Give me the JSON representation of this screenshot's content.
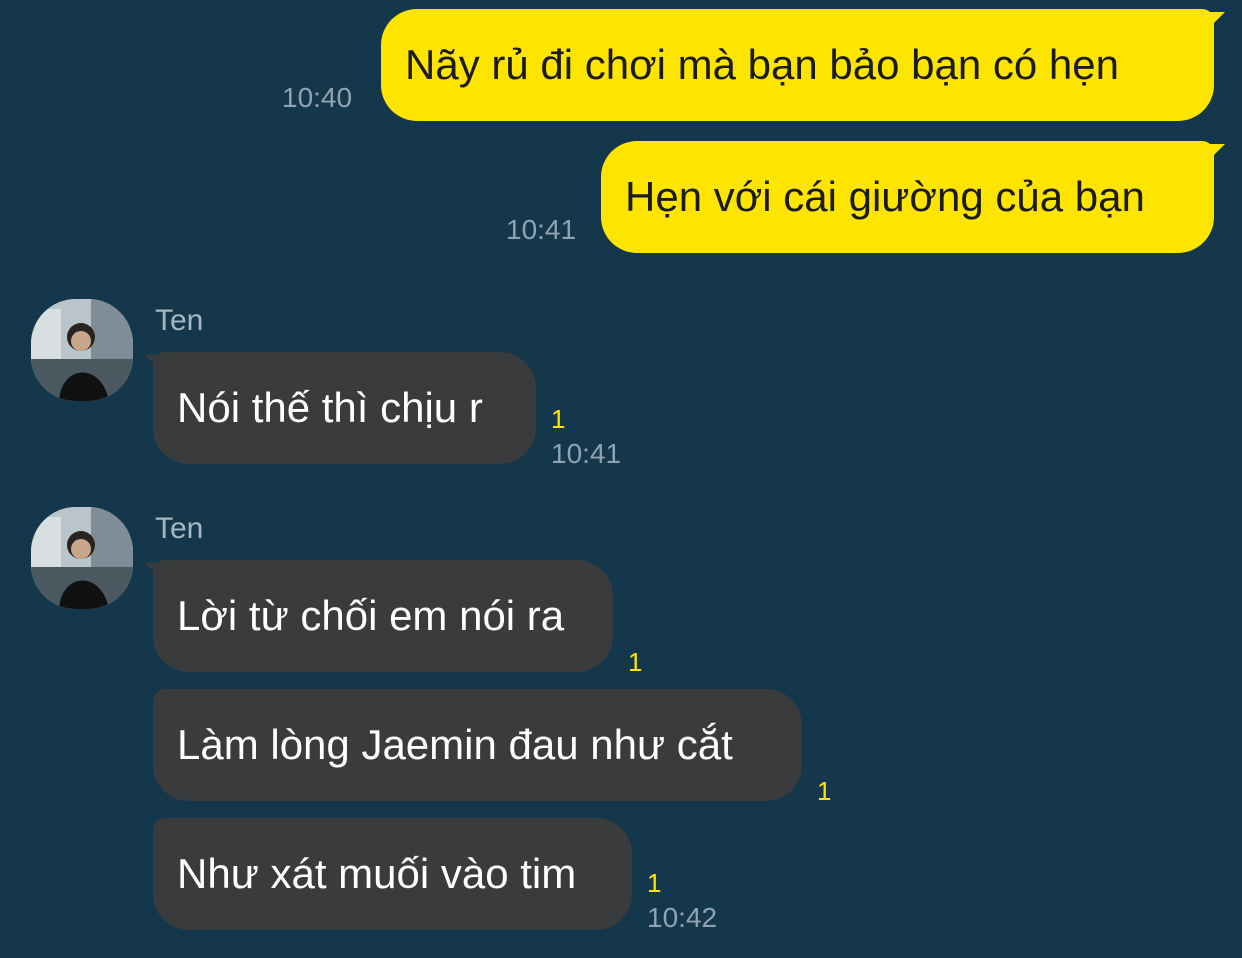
{
  "messages": [
    {
      "direction": "out",
      "text": "Nãy rủ đi chơi mà bạn bảo bạn có hẹn",
      "time": "10:40"
    },
    {
      "direction": "out",
      "text": "Hẹn với cái giường của bạn",
      "time": "10:41"
    },
    {
      "direction": "in",
      "sender": "Ten",
      "text": "Nói thế thì chịu r",
      "unread": "1",
      "time": "10:41"
    },
    {
      "direction": "in",
      "sender": "Ten",
      "text": "Lời từ chối em nói ra",
      "unread": "1"
    },
    {
      "direction": "in",
      "text": "Làm lòng Jaemin đau như cắt",
      "unread": "1"
    },
    {
      "direction": "in",
      "text": "Như xát muối vào tim",
      "unread": "1",
      "time": "10:42"
    }
  ],
  "icons": {
    "avatar": "profile-photo-avatar"
  },
  "colors": {
    "background": "#14374b",
    "outgoing_bubble": "#fee500",
    "incoming_bubble": "#3a3b3d",
    "unread_count": "#fee500",
    "timestamp": "#8fa3b0"
  }
}
